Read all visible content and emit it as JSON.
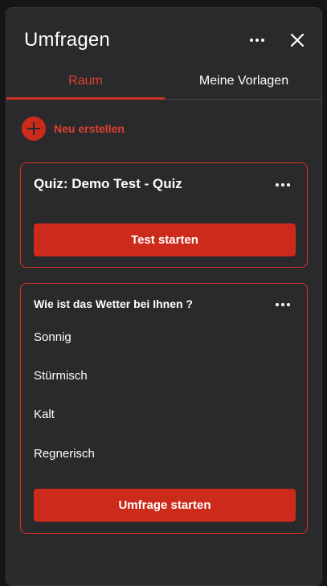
{
  "header": {
    "title": "Umfragen",
    "more_icon": "more-horizontal-icon",
    "close_icon": "close-icon"
  },
  "tabs": [
    {
      "label": "Raum",
      "active": true
    },
    {
      "label": "Meine Vorlagen",
      "active": false
    }
  ],
  "create": {
    "label": "Neu erstellen",
    "icon": "plus-circle-icon"
  },
  "quiz_card": {
    "title": "Quiz: Demo Test - Quiz",
    "button_label": "Test starten"
  },
  "poll_card": {
    "title": "Wie ist das Wetter bei Ihnen ?",
    "options": [
      "Sonnig",
      "Stürmisch",
      "Kalt",
      "Regnerisch"
    ],
    "button_label": "Umfrage starten"
  },
  "colors": {
    "accent": "#cc2b1c",
    "accent_text": "#e0402e",
    "panel_bg": "#2a2a2d",
    "page_bg": "#161618"
  }
}
